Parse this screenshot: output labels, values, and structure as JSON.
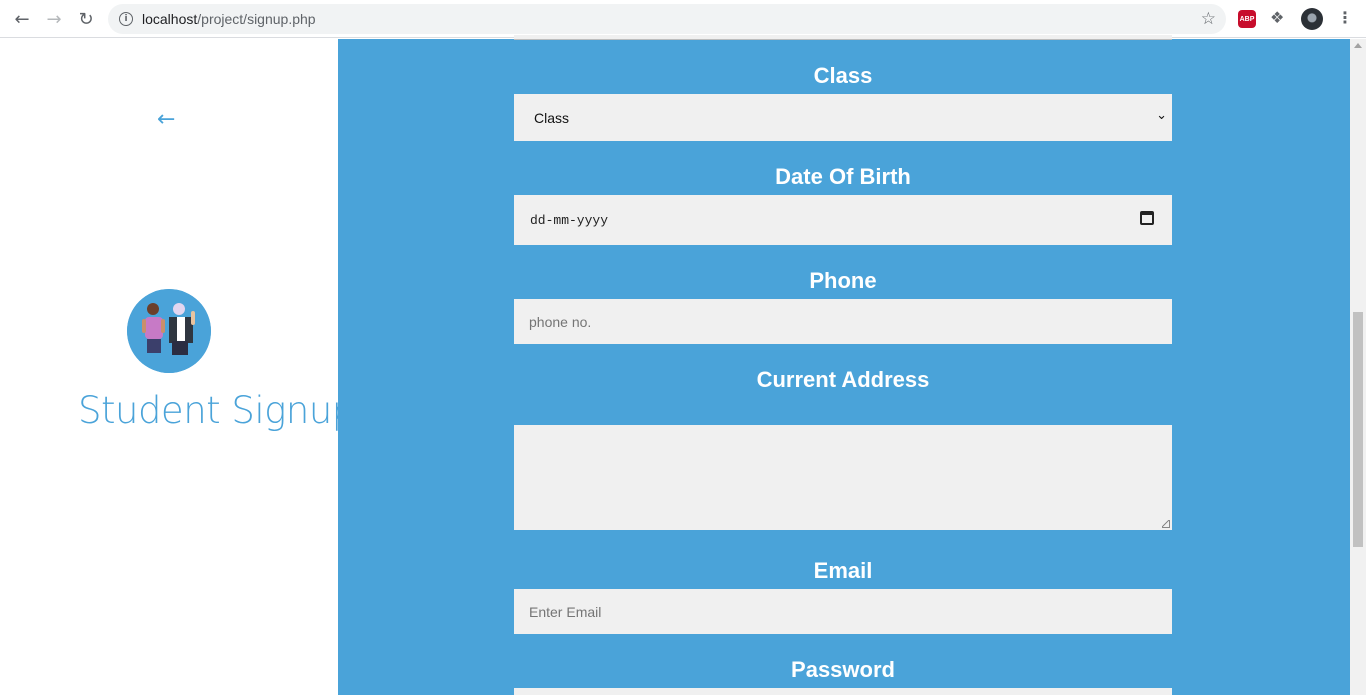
{
  "browser": {
    "url_host": "localhost",
    "url_path": "/project/signup.php",
    "abp_label": "ABP"
  },
  "sidebar": {
    "title": "Student Signup"
  },
  "form": {
    "class": {
      "label": "Class",
      "selected": "Class"
    },
    "dob": {
      "label": "Date Of Birth",
      "placeholder": "dd-mm-yyyy"
    },
    "phone": {
      "label": "Phone",
      "placeholder": "phone no."
    },
    "address": {
      "label": "Current Address",
      "value": ""
    },
    "email": {
      "label": "Email",
      "placeholder": "Enter Email"
    },
    "password": {
      "label": "Password"
    }
  },
  "colors": {
    "accent": "#4aa3d9",
    "field_bg": "#f0f0f0"
  }
}
